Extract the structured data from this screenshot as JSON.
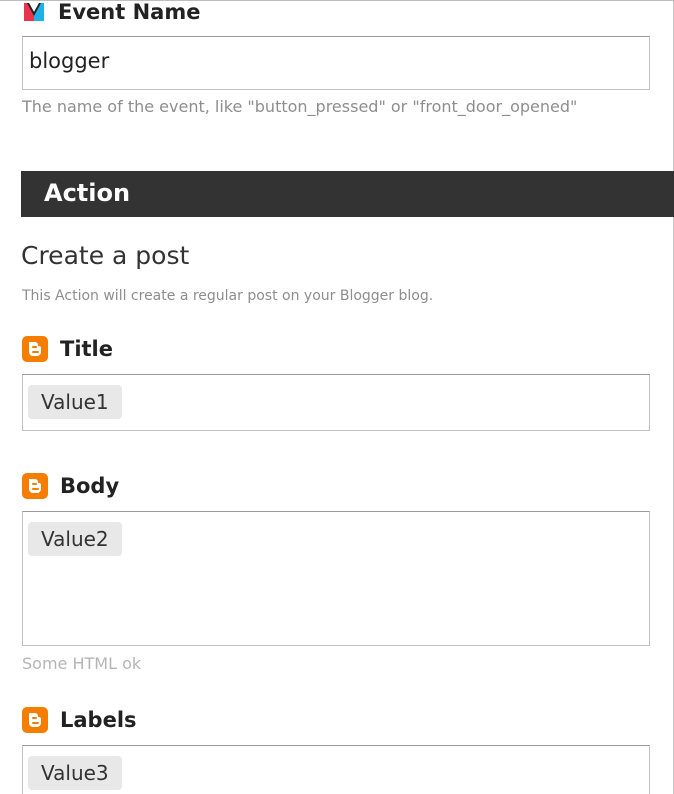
{
  "event": {
    "label": "Event Name",
    "value": "blogger",
    "help": "The name of the event, like \"button_pressed\" or \"front_door_opened\""
  },
  "action": {
    "section_label": "Action",
    "title": "Create a post",
    "description": "This Action will create a regular post on your Blogger blog."
  },
  "fields": {
    "title": {
      "label": "Title",
      "value": "Value1"
    },
    "body": {
      "label": "Body",
      "value": "Value2",
      "help": "Some HTML ok"
    },
    "labels": {
      "label": "Labels",
      "value": "Value3"
    }
  },
  "icons": {
    "maker": "maker-service-icon",
    "blogger": "blogger-icon"
  },
  "colors": {
    "blogger_orange": "#f57d00",
    "action_bar": "#333333",
    "maker_red": "#e8344e",
    "maker_blue": "#1fb1e6"
  }
}
